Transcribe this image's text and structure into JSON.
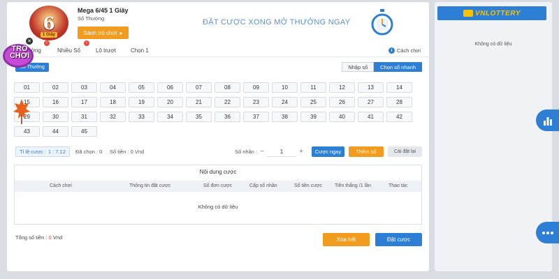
{
  "header": {
    "logo_number": "6",
    "logo_tag": "1 Giây",
    "game_title": "Mega 6/45 1 Giây",
    "game_subtitle": "Số Thường",
    "lobby_button": "Sảnh trò chơi",
    "banner_text": "ĐẶT CƯỢC XONG MỞ THƯỞNG NGAY"
  },
  "tabs": [
    {
      "label": "Thường"
    },
    {
      "label": "Nhiều Số"
    },
    {
      "label": "Lô trượt"
    },
    {
      "label": "Chọn 1"
    }
  ],
  "guide_label": "Cách chơi",
  "mode_pill": "Số Thường",
  "quick_select": {
    "pick": "Nhập số",
    "fast": "Chọn số nhanh"
  },
  "numbers": [
    "01",
    "02",
    "03",
    "04",
    "05",
    "06",
    "07",
    "08",
    "09",
    "10",
    "11",
    "12",
    "13",
    "14",
    "15",
    "16",
    "17",
    "18",
    "19",
    "20",
    "21",
    "22",
    "23",
    "24",
    "25",
    "26",
    "27",
    "28",
    "29",
    "30",
    "31",
    "32",
    "33",
    "34",
    "35",
    "36",
    "37",
    "38",
    "39",
    "40",
    "41",
    "42",
    "43",
    "44",
    "45"
  ],
  "bet_bar": {
    "rate_label": "Tỉ lệ cược :",
    "rate_value": "1 : 7.12",
    "picked": "Đã chọn : 0",
    "money": "Số tiền : 0 Vnd",
    "multiplier_label": "Số nhân :",
    "multiplier_value": "1",
    "bet_now": "Cược ngay",
    "add_number": "Thêm số",
    "reset": "Cài đặt lại"
  },
  "bet_table": {
    "title": "Nội dung cược",
    "columns": [
      "Cách chơi",
      "Thông tin đặt cược",
      "Số đơn cược",
      "Cấp số nhân",
      "Số tiền cược",
      "Tiền thắng /1 lần",
      "Thao tác"
    ],
    "empty": "Không có dữ liệu"
  },
  "footer": {
    "total_label": "Tổng số tiền :",
    "total_amount": "0",
    "total_unit": "Vnd",
    "clear": "Xóa hết",
    "place": "Đặt cược"
  },
  "right_panel": {
    "brand": "VNLOTTERY",
    "no_data": "Không có dữ liệu"
  },
  "promo": {
    "text": "TRÒ CHƠI"
  },
  "colors": {
    "primary": "#2d7fd6",
    "orange": "#f29c1f",
    "red": "#e74c3c"
  }
}
